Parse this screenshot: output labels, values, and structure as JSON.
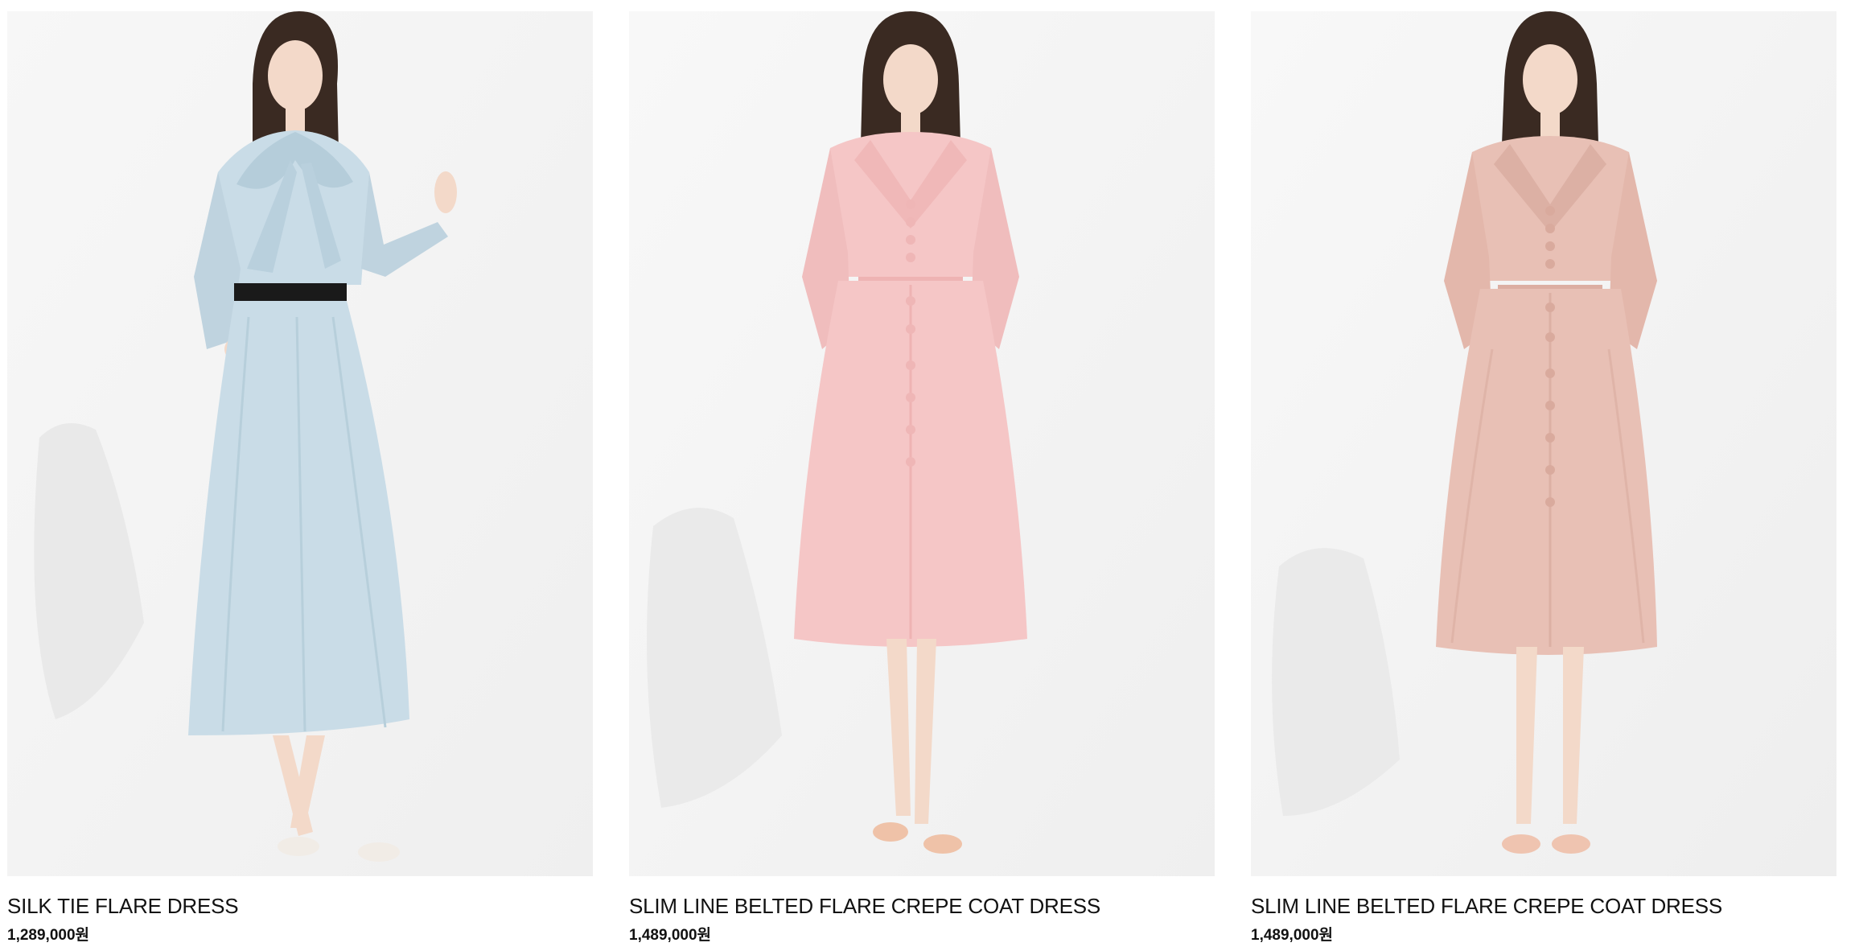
{
  "products": [
    {
      "name": "SILK TIE FLARE DRESS",
      "price": "1,289,000원",
      "dress_color": "#c9dce7",
      "accent_color": "#1a1a1a",
      "shoe_color": "#f1ece6"
    },
    {
      "name": "SLIM LINE BELTED FLARE CREPE COAT DRESS",
      "price": "1,489,000원",
      "dress_color": "#f5c6c6",
      "accent_color": "#f0b8b8",
      "shoe_color": "#efc2a8"
    },
    {
      "name": "SLIM LINE BELTED FLARE CREPE COAT DRESS",
      "price": "1,489,000원",
      "dress_color": "#e8c0b5",
      "accent_color": "#dcb0a4",
      "shoe_color": "#efc4b0"
    }
  ],
  "colors": {
    "photo_background": "#f4f4f4",
    "text": "#111111",
    "hair": "#3a2a22",
    "skin": "#f3d9c9"
  }
}
